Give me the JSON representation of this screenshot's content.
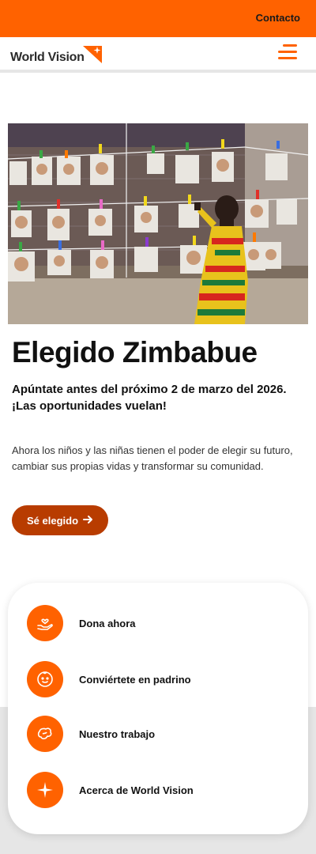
{
  "topbar": {
    "contact_label": "Contacto"
  },
  "header": {
    "logo_text": "World Vision"
  },
  "hero": {
    "title": "Elegido Zimbabue",
    "subtitle_line1": "Apúntate antes del próximo 2 de marzo del 2026.",
    "subtitle_line2": "¡Las oportunidades vuelan!",
    "description": "Ahora los niños y las niñas tienen el poder de elegir su futuro, cambiar sus propias vidas y transformar su comunidad.",
    "cta_label": "Sé elegido"
  },
  "quick_links": [
    {
      "label": "Dona ahora",
      "icon": "hand-heart-icon"
    },
    {
      "label": "Conviértete en padrino",
      "icon": "child-face-icon"
    },
    {
      "label": "Nuestro trabajo",
      "icon": "map-icon"
    },
    {
      "label": "Acerca de World Vision",
      "icon": "star-sparkle-icon"
    }
  ],
  "colors": {
    "brand_orange": "#ff6200",
    "cta_brown": "#b83c00",
    "panel_grey": "#e6e6e6"
  }
}
